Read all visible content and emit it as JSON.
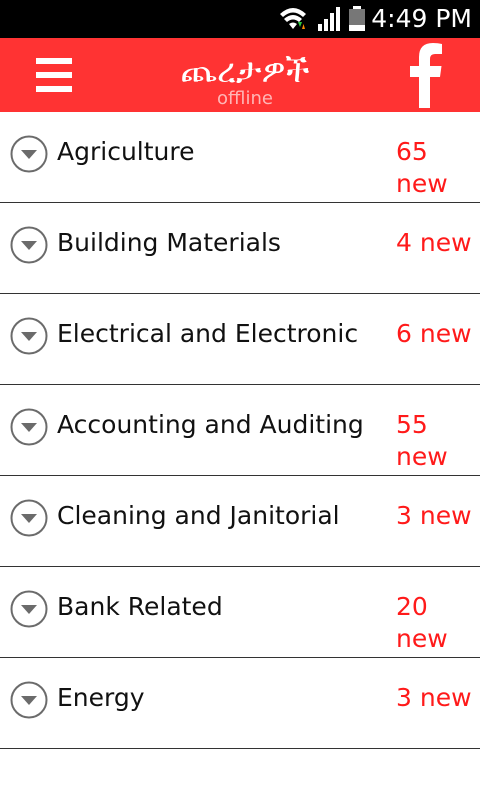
{
  "status_bar": {
    "time": "4:49 PM",
    "icons": [
      "wifi-icon",
      "signal-icon",
      "battery-icon"
    ]
  },
  "app_bar": {
    "title": "ጨረታዎች",
    "subtitle": "offline",
    "menu_icon": "hamburger-menu-icon",
    "facebook_icon": "facebook-icon",
    "background_color": "#ff3333"
  },
  "categories": [
    {
      "name": "Agriculture",
      "count": "65 new"
    },
    {
      "name": "Building Materials",
      "count": "4 new"
    },
    {
      "name": "Electrical and Electronic",
      "count": "6 new"
    },
    {
      "name": "Accounting and Auditing",
      "count": "55 new"
    },
    {
      "name": "Cleaning and Janitorial",
      "count": "3 new"
    },
    {
      "name": "Bank Related",
      "count": "20 new"
    },
    {
      "name": "Energy",
      "count": "3 new"
    }
  ],
  "colors": {
    "accent": "#ff3333",
    "count_text": "#ff1a1a"
  }
}
